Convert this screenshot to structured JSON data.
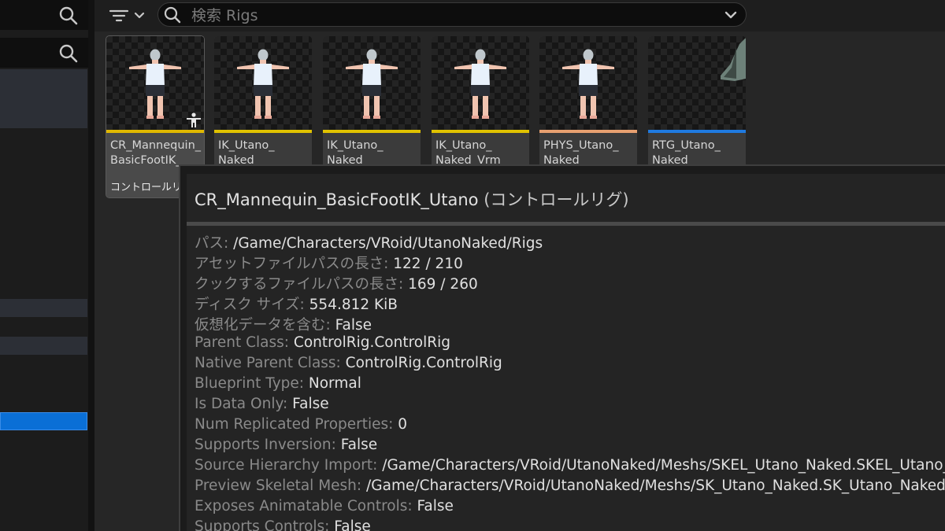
{
  "search": {
    "placeholder": "検索 Rigs",
    "value": ""
  },
  "assets": [
    {
      "name": "CR_Mannequin_\nBasicFootIK_",
      "type": "コントロールリ",
      "bar_color": "#e0b800",
      "selected": true,
      "badge": "figure-icon"
    },
    {
      "name": "IK_Utano_\nNaked",
      "type": "",
      "bar_color": "#e0c200",
      "selected": false
    },
    {
      "name": "IK_Utano_\nNaked",
      "type": "",
      "bar_color": "#e0c200",
      "selected": false
    },
    {
      "name": "IK_Utano_\nNaked_Vrm",
      "type": "",
      "bar_color": "#e0c200",
      "selected": false
    },
    {
      "name": "PHYS_Utano_\nNaked",
      "type": "",
      "bar_color": "#e8a070",
      "selected": false
    },
    {
      "name": "RTG_Utano_\nNaked",
      "type": "",
      "bar_color": "#1f7ae0",
      "selected": false
    }
  ],
  "tooltip": {
    "title": "CR_Mannequin_BasicFootIK_Utano",
    "type_label": "(コントロールリグ)",
    "rows": [
      {
        "key": "パス:",
        "value": "/Game/Characters/VRoid/UtanoNaked/Rigs"
      },
      {
        "key": "アセットファイルパスの長さ:",
        "value": "122 / 210"
      },
      {
        "key": "クックするファイルパスの長さ:",
        "value": "169 / 260"
      },
      {
        "key": "ディスク サイズ:",
        "value": "554.812 KiB"
      },
      {
        "key": "仮想化データを含む:",
        "value": "False"
      },
      {
        "key": "Parent Class:",
        "value": "ControlRig.ControlRig"
      },
      {
        "key": "Native Parent Class:",
        "value": "ControlRig.ControlRig"
      },
      {
        "key": "Blueprint Type:",
        "value": "Normal"
      },
      {
        "key": "Is Data Only:",
        "value": "False"
      },
      {
        "key": "Num Replicated Properties:",
        "value": "0"
      },
      {
        "key": "Supports Inversion:",
        "value": "False"
      },
      {
        "key": "Source Hierarchy Import:",
        "value": "/Game/Characters/VRoid/UtanoNaked/Meshs/SKEL_Utano_Naked.SKEL_Utano_N"
      },
      {
        "key": "Preview Skeletal Mesh:",
        "value": "/Game/Characters/VRoid/UtanoNaked/Meshs/SK_Utano_Naked.SK_Utano_Naked"
      },
      {
        "key": "Exposes Animatable Controls:",
        "value": "False"
      },
      {
        "key": "Supports Controls:",
        "value": "False"
      }
    ]
  },
  "colors": {
    "selection_blue": "#0a6fd6",
    "accent_yellow": "#e0c200",
    "physics_orange": "#e8a070",
    "retarget_blue": "#1f7ae0"
  }
}
